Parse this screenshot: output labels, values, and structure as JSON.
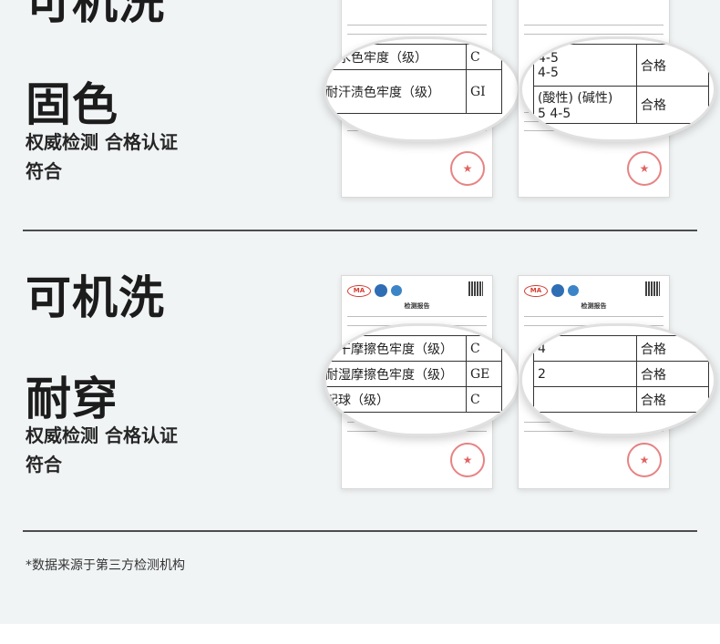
{
  "section_top": {
    "title_partial": "可机洗",
    "title": "固色",
    "subtitle": "权威检测 合格认证\n符合",
    "left_bubble_rows": [
      {
        "label": "耐水色牢度（级）",
        "code": "C"
      },
      {
        "label": "耐汗渍色牢度（级）",
        "code": "GI"
      }
    ],
    "right_bubble_rows": [
      {
        "value": "4-5\n4-5",
        "result": "合格"
      },
      {
        "value": "(酸性) (碱性)\n5    4-5",
        "result": "合格"
      }
    ]
  },
  "section_bottom": {
    "title": "可机洗",
    "title2": "耐穿",
    "subtitle": "权威检测 合格认证\n符合",
    "left_bubble_rows": [
      {
        "label": "耐干摩擦色牢度（级）",
        "code": "C"
      },
      {
        "label": "耐湿摩擦色牢度（级）",
        "code": "GE"
      },
      {
        "label": "起球（级）",
        "code": "C"
      }
    ],
    "right_bubble_rows": [
      {
        "value": "4",
        "result": "合格"
      },
      {
        "value": "2",
        "result": "合格"
      },
      {
        "value": "",
        "result": "合格"
      }
    ],
    "report_title": "检测报告"
  },
  "footnote": "*数据来源于第三方检测机构",
  "colors": {
    "background": "#f1f4f5",
    "divider": "#4d4d4d",
    "stamp": "#d93030"
  }
}
